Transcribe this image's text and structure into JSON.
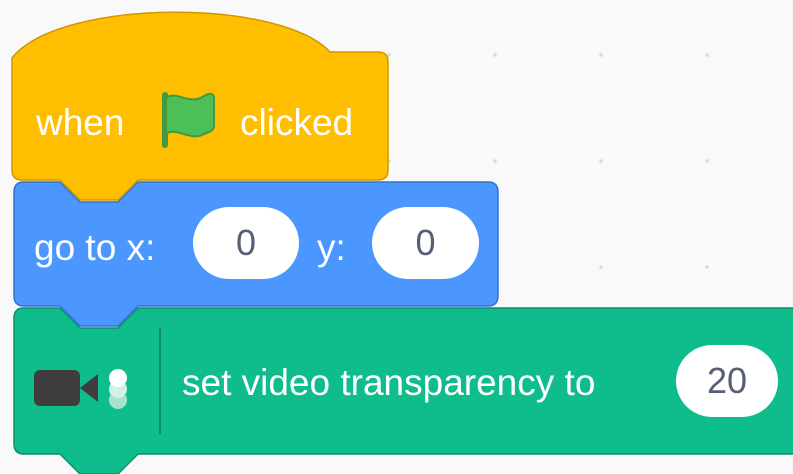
{
  "script": {
    "hat_block": {
      "text_before": "when",
      "icon": "green-flag-icon",
      "text_after": "clicked",
      "color": "#ffbf00",
      "border": "#cc9900"
    },
    "motion_block": {
      "label_x": "go to x:",
      "x_value": "0",
      "label_y": "y:",
      "y_value": "0",
      "color": "#4c97ff",
      "border": "#3373cc"
    },
    "video_block": {
      "icon": "video-sensing-icon",
      "label": "set video transparency to",
      "value": "20",
      "color": "#0fbd8c",
      "border": "#0b8e69"
    }
  },
  "colors": {
    "workspace_background": "#f9f9f9",
    "grid_dot": "#d9d9d9",
    "flag_green": "#4cbf56",
    "input_text": "#575e75"
  }
}
